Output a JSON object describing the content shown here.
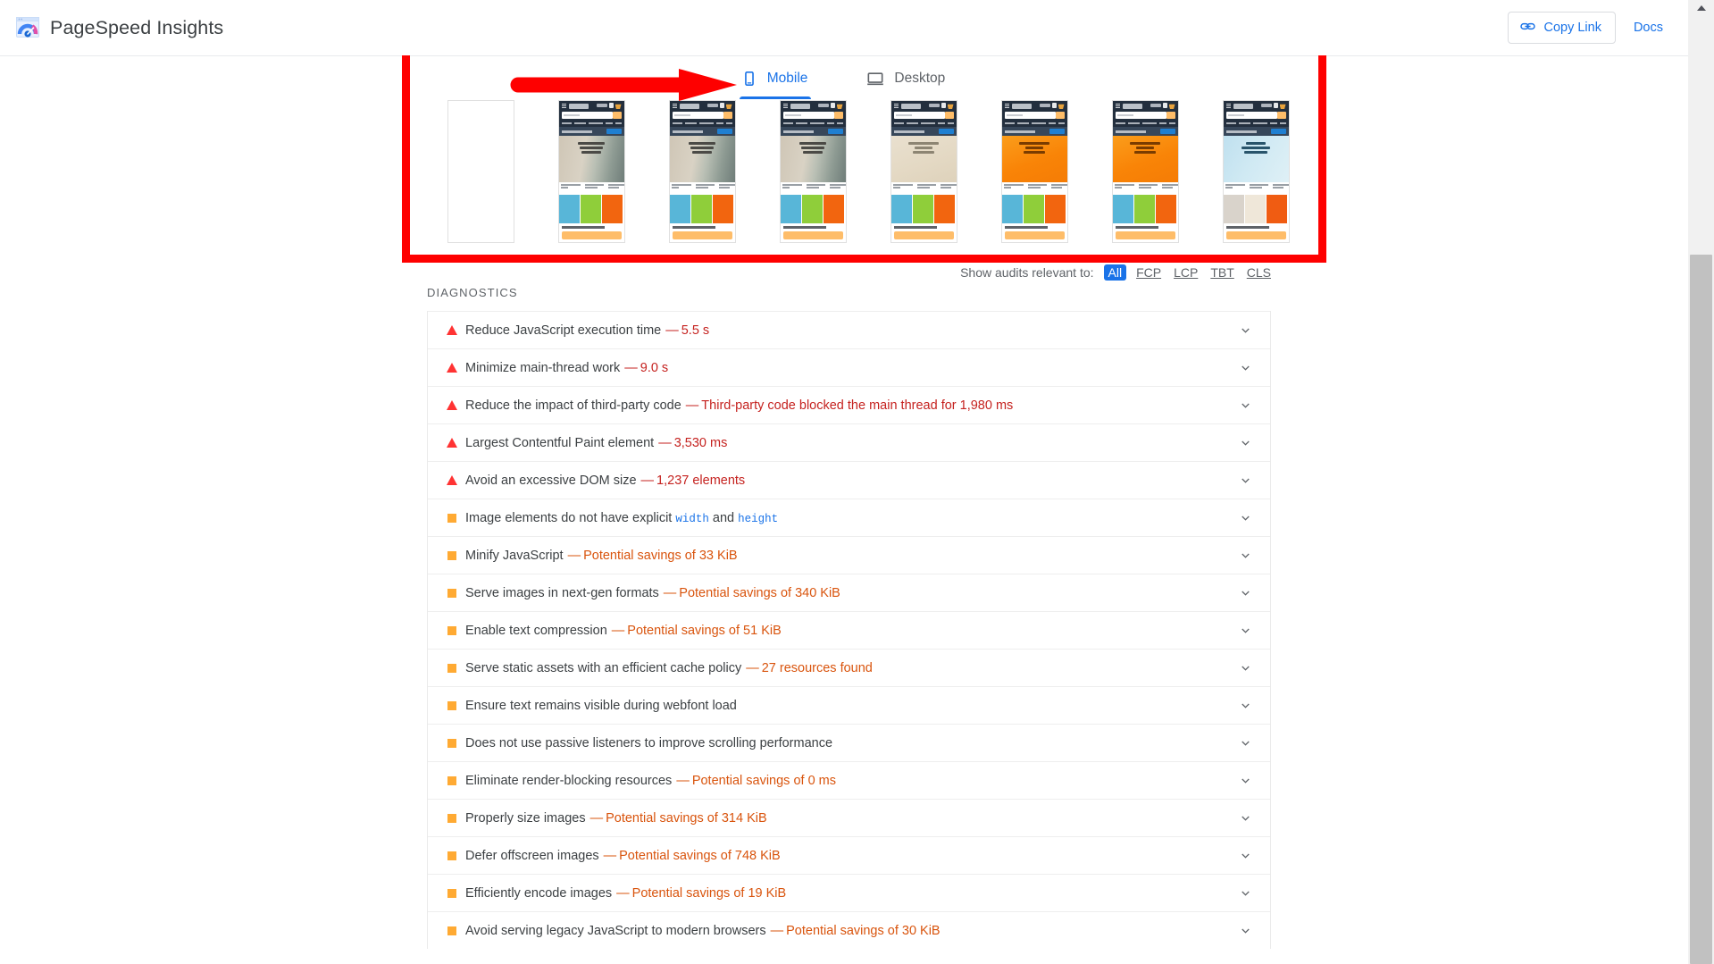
{
  "app": {
    "title": "PageSpeed Insights",
    "logo_icon": "pagespeed-logo-icon"
  },
  "header": {
    "copy_link_label": "Copy Link",
    "copy_link_icon": "link-chain-icon",
    "docs_label": "Docs"
  },
  "tabs": [
    {
      "label": "Mobile",
      "icon": "mobile-phone-icon",
      "active": true
    },
    {
      "label": "Desktop",
      "icon": "desktop-monitor-icon",
      "active": false
    }
  ],
  "annotation": {
    "highlight_box_color": "#fe0000",
    "arrow_color": "#fe0000",
    "arrow_points_to": "Mobile"
  },
  "filmstrip": {
    "frames": [
      {
        "state": "blank",
        "theme": "blank"
      },
      {
        "state": "loaded",
        "theme": "window-box"
      },
      {
        "state": "loaded",
        "theme": "window-box"
      },
      {
        "state": "loaded",
        "theme": "window-box"
      },
      {
        "state": "loaded",
        "theme": "garfield-pale"
      },
      {
        "state": "loaded",
        "theme": "garfield-orange"
      },
      {
        "state": "loaded",
        "theme": "garfield-orange"
      },
      {
        "state": "loaded",
        "theme": "korean-skincare"
      }
    ]
  },
  "filter": {
    "label": "Show audits relevant to:",
    "chips": [
      {
        "label": "All",
        "active": true
      },
      {
        "label": "FCP",
        "active": false
      },
      {
        "label": "LCP",
        "active": false
      },
      {
        "label": "TBT",
        "active": false
      },
      {
        "label": "CLS",
        "active": false
      }
    ],
    "active_accent": "#1a73e8"
  },
  "diagnostics": {
    "section_label": "DIAGNOSTICS",
    "audits": [
      {
        "icon": "triangle-warning-icon",
        "severity": "error",
        "title": "Reduce JavaScript execution time",
        "metric": "5.5 s"
      },
      {
        "icon": "triangle-warning-icon",
        "severity": "error",
        "title": "Minimize main-thread work",
        "metric": "9.0 s"
      },
      {
        "icon": "triangle-warning-icon",
        "severity": "error",
        "title": "Reduce the impact of third-party code",
        "metric": "Third-party code blocked the main thread for 1,980 ms"
      },
      {
        "icon": "triangle-warning-icon",
        "severity": "error",
        "title": "Largest Contentful Paint element",
        "metric": "3,530 ms"
      },
      {
        "icon": "triangle-warning-icon",
        "severity": "error",
        "title": "Avoid an excessive DOM size",
        "metric": "1,237 elements"
      },
      {
        "icon": "square-warning-icon",
        "severity": "warning",
        "title": "Image elements do not have explicit",
        "metric": "",
        "code_parts": [
          "width",
          "height"
        ],
        "code_joiner": "and"
      },
      {
        "icon": "square-warning-icon",
        "severity": "warning",
        "title": "Minify JavaScript",
        "metric": "Potential savings of 33 KiB"
      },
      {
        "icon": "square-warning-icon",
        "severity": "warning",
        "title": "Serve images in next-gen formats",
        "metric": "Potential savings of 340 KiB"
      },
      {
        "icon": "square-warning-icon",
        "severity": "warning",
        "title": "Enable text compression",
        "metric": "Potential savings of 51 KiB"
      },
      {
        "icon": "square-warning-icon",
        "severity": "warning",
        "title": "Serve static assets with an efficient cache policy",
        "metric": "27 resources found"
      },
      {
        "icon": "square-warning-icon",
        "severity": "warning",
        "title": "Ensure text remains visible during webfont load",
        "metric": ""
      },
      {
        "icon": "square-warning-icon",
        "severity": "warning",
        "title": "Does not use passive listeners to improve scrolling performance",
        "metric": ""
      },
      {
        "icon": "square-warning-icon",
        "severity": "warning",
        "title": "Eliminate render-blocking resources",
        "metric": "Potential savings of 0 ms"
      },
      {
        "icon": "square-warning-icon",
        "severity": "warning",
        "title": "Properly size images",
        "metric": "Potential savings of 314 KiB"
      },
      {
        "icon": "square-warning-icon",
        "severity": "warning",
        "title": "Defer offscreen images",
        "metric": "Potential savings of 748 KiB"
      },
      {
        "icon": "square-warning-icon",
        "severity": "warning",
        "title": "Efficiently encode images",
        "metric": "Potential savings of 19 KiB"
      },
      {
        "icon": "square-warning-icon",
        "severity": "warning",
        "title": "Avoid serving legacy JavaScript to modern browsers",
        "metric": "Potential savings of 30 KiB"
      }
    ],
    "expand_icon": "chevron-down-icon",
    "error_color": "#c5221f",
    "warning_color": "#d9540d"
  },
  "scrollbar": {
    "up_icon": "scroll-up-arrow-icon"
  }
}
